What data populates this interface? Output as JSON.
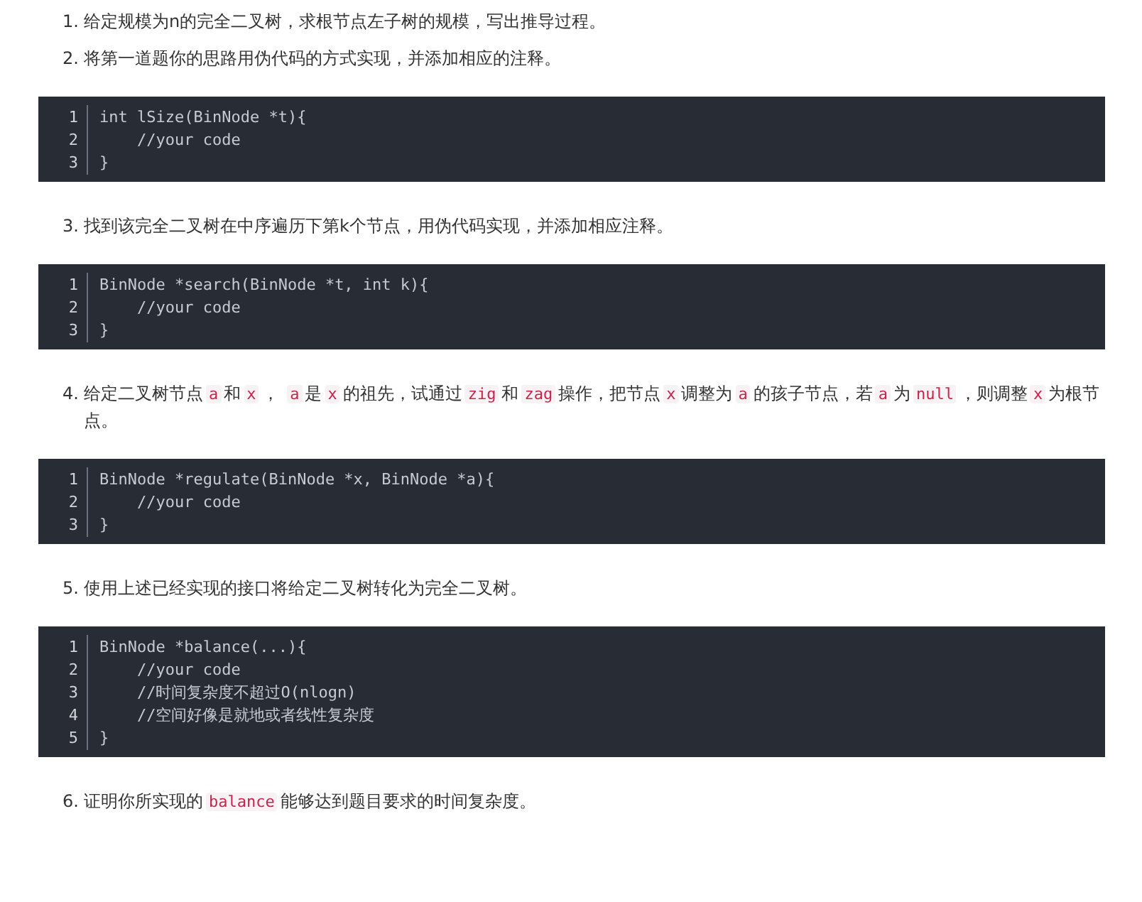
{
  "blocks": [
    {
      "kind": "item",
      "number": "1.",
      "segments": [
        {
          "kind": "text",
          "text": "给定规模为n的完全二叉树，求根节点左子树的规模，写出推导过程。"
        }
      ]
    },
    {
      "kind": "item",
      "number": "2.",
      "segments": [
        {
          "kind": "text",
          "text": "将第一道题你的思路用伪代码的方式实现，并添加相应的注释。"
        }
      ]
    },
    {
      "kind": "code",
      "lines": [
        {
          "number": "1",
          "code": "int lSize(BinNode *t){"
        },
        {
          "number": "2",
          "code": "    //your code"
        },
        {
          "number": "3",
          "code": "}"
        }
      ]
    },
    {
      "kind": "item",
      "number": "3.",
      "segments": [
        {
          "kind": "text",
          "text": "找到该完全二叉树在中序遍历下第k个节点，用伪代码实现，并添加相应注释。"
        }
      ]
    },
    {
      "kind": "code",
      "lines": [
        {
          "number": "1",
          "code": "BinNode *search(BinNode *t, int k){"
        },
        {
          "number": "2",
          "code": "    //your code"
        },
        {
          "number": "3",
          "code": "}"
        }
      ]
    },
    {
      "kind": "item",
      "number": "4.",
      "segments": [
        {
          "kind": "text",
          "text": "给定二叉树节点"
        },
        {
          "kind": "code",
          "text": "a"
        },
        {
          "kind": "text",
          "text": "和"
        },
        {
          "kind": "code",
          "text": "x"
        },
        {
          "kind": "text",
          "text": "， "
        },
        {
          "kind": "code",
          "text": "a"
        },
        {
          "kind": "text",
          "text": "是"
        },
        {
          "kind": "code",
          "text": "x"
        },
        {
          "kind": "text",
          "text": "的祖先，试通过"
        },
        {
          "kind": "code",
          "text": "zig"
        },
        {
          "kind": "text",
          "text": "和"
        },
        {
          "kind": "code",
          "text": "zag"
        },
        {
          "kind": "text",
          "text": "操作，把节点"
        },
        {
          "kind": "code",
          "text": "x"
        },
        {
          "kind": "text",
          "text": "调整为"
        },
        {
          "kind": "code",
          "text": "a"
        },
        {
          "kind": "text",
          "text": "的孩子节点，若"
        },
        {
          "kind": "code",
          "text": "a"
        },
        {
          "kind": "text",
          "text": "为"
        },
        {
          "kind": "code",
          "text": "null"
        },
        {
          "kind": "text",
          "text": "，则调整"
        },
        {
          "kind": "code",
          "text": "x"
        },
        {
          "kind": "text",
          "text": "为根节点。"
        }
      ]
    },
    {
      "kind": "code",
      "lines": [
        {
          "number": "1",
          "code": "BinNode *regulate(BinNode *x, BinNode *a){"
        },
        {
          "number": "2",
          "code": "    //your code"
        },
        {
          "number": "3",
          "code": "}"
        }
      ]
    },
    {
      "kind": "item",
      "number": "5.",
      "segments": [
        {
          "kind": "text",
          "text": "使用上述已经实现的接口将给定二叉树转化为完全二叉树。"
        }
      ]
    },
    {
      "kind": "code",
      "lines": [
        {
          "number": "1",
          "code": "BinNode *balance(...){"
        },
        {
          "number": "2",
          "code": "    //your code"
        },
        {
          "number": "3",
          "code": "    //时间复杂度不超过O(nlogn)"
        },
        {
          "number": "4",
          "code": "    //空间好像是就地或者线性复杂度"
        },
        {
          "number": "5",
          "code": "}"
        }
      ]
    },
    {
      "kind": "item",
      "number": "6.",
      "segments": [
        {
          "kind": "text",
          "text": "证明你所实现的"
        },
        {
          "kind": "code",
          "text": "balance"
        },
        {
          "kind": "text",
          "text": "能够达到题目要求的时间复杂度。"
        }
      ]
    }
  ]
}
